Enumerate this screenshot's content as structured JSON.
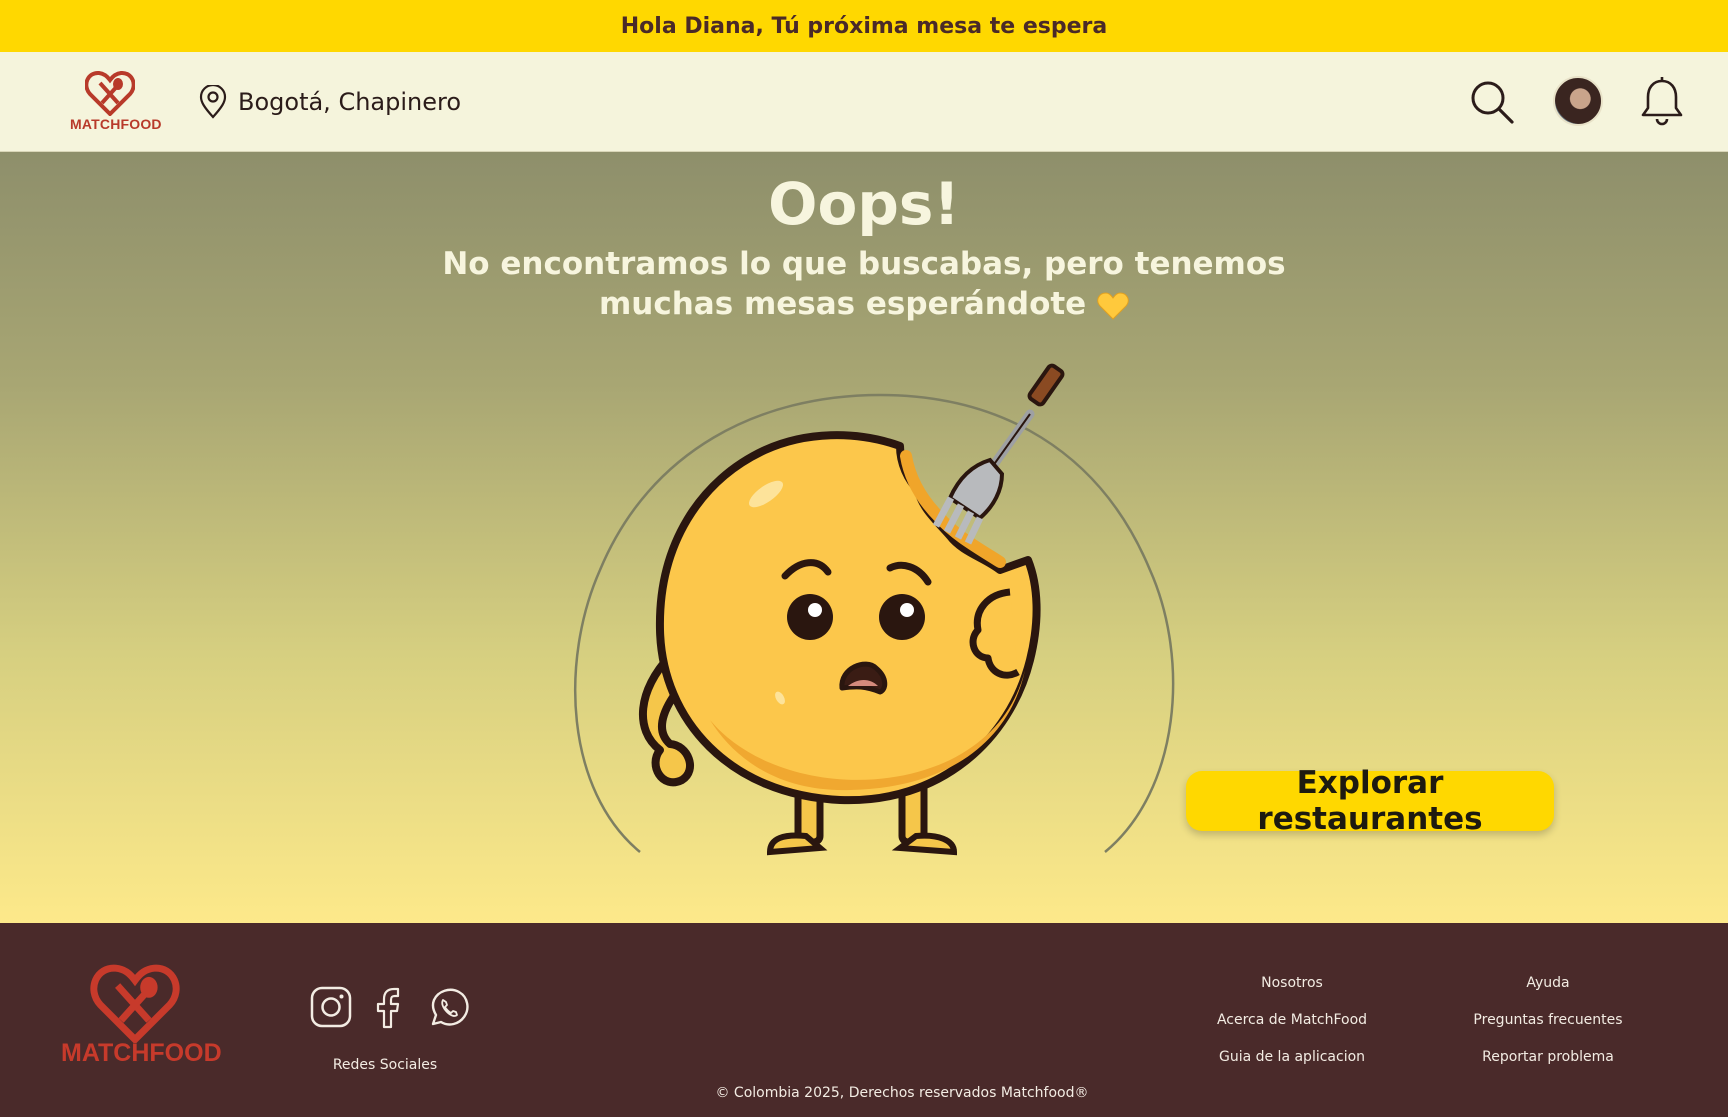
{
  "banner": {
    "greeting": "Hola Diana, Tú próxima mesa te espera"
  },
  "header": {
    "logo_text": "MATCHFOOD",
    "location": "Bogotá, Chapinero",
    "icons": [
      "location-pin-icon",
      "search-icon",
      "avatar",
      "bell-icon"
    ]
  },
  "main": {
    "title": "Oops!",
    "subtitle": "No encontramos lo que buscabas, pero tenemos muchas mesas esperándote",
    "subtitle_emoji": "yellow-heart-icon",
    "cta_label": "Explorar restaurantes"
  },
  "footer": {
    "logo_text": "MATCHFOOD",
    "socials_label": "Redes Sociales",
    "social_icons": [
      "instagram-icon",
      "facebook-icon",
      "whatsapp-icon"
    ],
    "col1": [
      "Nosotros",
      "Acerca de MatchFood",
      "Guia de la aplicacion"
    ],
    "col2": [
      "Ayuda",
      "Preguntas frecuentes",
      "Reportar problema"
    ],
    "copyright": "© Colombia 2025, Derechos reservados Matchfood®"
  },
  "colors": {
    "banner": "#ffd800",
    "header_bg": "#f5f4dc",
    "footer_bg": "#4a2a2a",
    "brand_red": "#c73a2b",
    "cta": "#ffd800"
  }
}
